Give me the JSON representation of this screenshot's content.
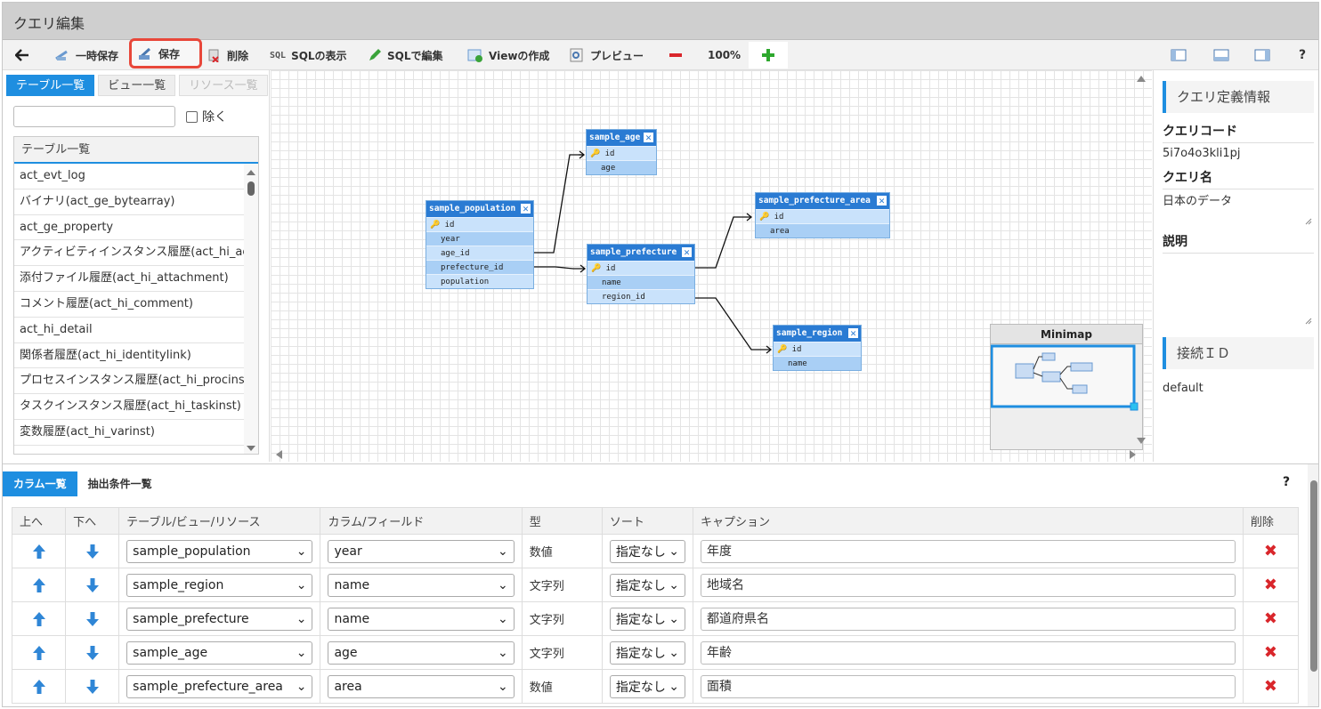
{
  "window": {
    "title": "クエリ編集"
  },
  "toolbar": {
    "temp_save": "一時保存",
    "save": "保存",
    "delete": "削除",
    "show_sql": "SQLの表示",
    "edit_sql": "SQLで編集",
    "create_view": "Viewの作成",
    "preview": "プレビュー",
    "zoom": "100%",
    "help": "?"
  },
  "left_panel": {
    "tabs": [
      {
        "label": "テーブル一覧",
        "active": true
      },
      {
        "label": "ビュー一覧",
        "active": false
      },
      {
        "label": "リソース一覧",
        "active": false
      }
    ],
    "filter_placeholder": "",
    "exclude_label": "除く",
    "list_header": "テーブル一覧",
    "items": [
      "act_evt_log",
      "バイナリ(act_ge_bytearray)",
      "act_ge_property",
      "アクティビティインスタンス履歴(act_hi_act",
      "添付ファイル履歴(act_hi_attachment)",
      "コメント履歴(act_hi_comment)",
      "act_hi_detail",
      "関係者履歴(act_hi_identitylink)",
      "プロセスインスタンス履歴(act_hi_procinst)",
      "タスクインスタンス履歴(act_hi_taskinst)",
      "変数履歴(act_hi_varinst)"
    ]
  },
  "diagram": {
    "tables": [
      {
        "name": "sample_age",
        "columns": [
          "id",
          "age"
        ]
      },
      {
        "name": "sample_population",
        "columns": [
          "id",
          "year",
          "age_id",
          "prefecture_id",
          "population"
        ]
      },
      {
        "name": "sample_prefecture",
        "columns": [
          "id",
          "name",
          "region_id"
        ]
      },
      {
        "name": "sample_prefecture_area",
        "columns": [
          "id",
          "area"
        ]
      },
      {
        "name": "sample_region",
        "columns": [
          "id",
          "name"
        ]
      }
    ],
    "minimap_title": "Minimap"
  },
  "right_panel": {
    "section_title": "クエリ定義情報",
    "code_label": "クエリコード",
    "code_value": "5i7o4o3kli1pj",
    "name_label": "クエリ名",
    "name_value": "日本のデータ",
    "desc_label": "説明",
    "desc_value": "",
    "connection_title": "接続ＩＤ",
    "connection_value": "default"
  },
  "bottom": {
    "tabs": [
      {
        "label": "カラム一覧",
        "active": true
      },
      {
        "label": "抽出条件一覧",
        "active": false
      }
    ],
    "help": "?",
    "headers": [
      "上へ",
      "下へ",
      "テーブル/ビュー/リソース",
      "カラム/フィールド",
      "型",
      "ソート",
      "キャプション",
      "削除"
    ],
    "rows": [
      {
        "table": "sample_population",
        "column": "year",
        "type": "数値",
        "sort": "指定なし",
        "caption": "年度"
      },
      {
        "table": "sample_region",
        "column": "name",
        "type": "文字列",
        "sort": "指定なし",
        "caption": "地域名"
      },
      {
        "table": "sample_prefecture",
        "column": "name",
        "type": "文字列",
        "sort": "指定なし",
        "caption": "都道府県名"
      },
      {
        "table": "sample_age",
        "column": "age",
        "type": "文字列",
        "sort": "指定なし",
        "caption": "年齢"
      },
      {
        "table": "sample_prefecture_area",
        "column": "area",
        "type": "数値",
        "sort": "指定なし",
        "caption": "面積"
      }
    ]
  },
  "colors": {
    "accent": "#1e8ee0",
    "table_header": "#2a7bd3",
    "delete": "#d9262b",
    "highlight": "#e8473a"
  }
}
